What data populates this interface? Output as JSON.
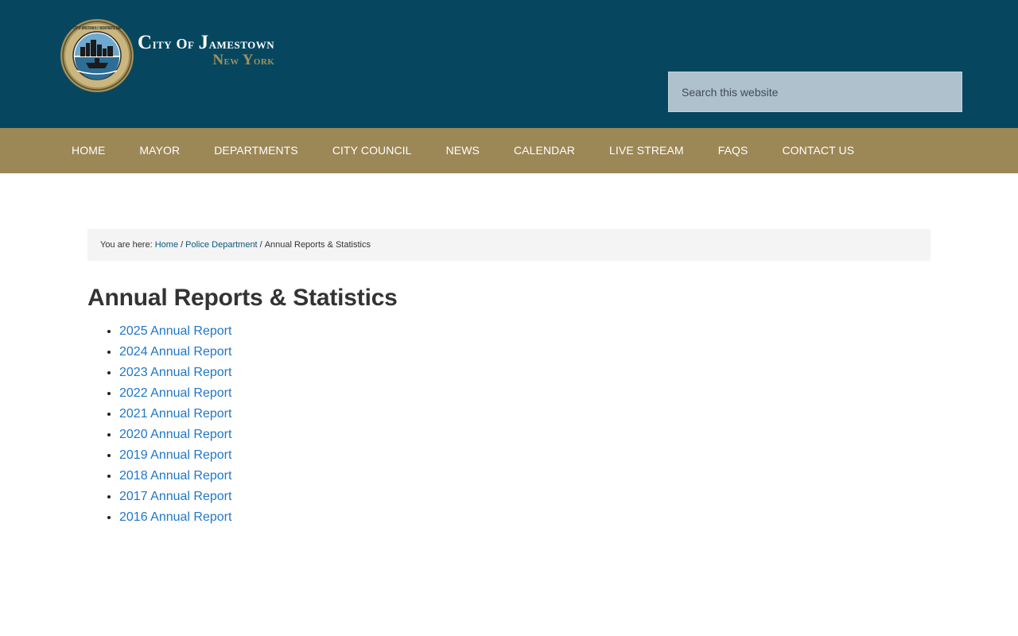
{
  "header": {
    "logo": {
      "city_text": "City of Jamestown",
      "state_text": "New York",
      "seal_text": "CITY OF JAMESTOWN N.Y. INCORPORATED 1886"
    },
    "search": {
      "placeholder": "Search this website",
      "value": ""
    }
  },
  "nav": {
    "items": [
      {
        "label": "HOME"
      },
      {
        "label": "MAYOR"
      },
      {
        "label": "DEPARTMENTS"
      },
      {
        "label": "CITY COUNCIL"
      },
      {
        "label": "NEWS"
      },
      {
        "label": "CALENDAR"
      },
      {
        "label": "LIVE STREAM"
      },
      {
        "label": "FAQS"
      },
      {
        "label": "CONTACT US"
      }
    ]
  },
  "breadcrumb": {
    "prefix": "You are here:",
    "links": [
      {
        "label": "Home"
      },
      {
        "label": "Police Department"
      }
    ],
    "separator": "/",
    "current": "Annual Reports & Statistics"
  },
  "main": {
    "title": "Annual Reports & Statistics",
    "reports": [
      {
        "label": "2025 Annual Report"
      },
      {
        "label": "2024 Annual Report"
      },
      {
        "label": "2023 Annual Report"
      },
      {
        "label": "2022 Annual Report"
      },
      {
        "label": "2021 Annual Report"
      },
      {
        "label": "2020 Annual Report"
      },
      {
        "label": "2019 Annual Report"
      },
      {
        "label": "2018 Annual Report"
      },
      {
        "label": "2017 Annual Report"
      },
      {
        "label": "2016 Annual Report"
      }
    ]
  },
  "colors": {
    "header_bg": "#06475f",
    "nav_bg": "#9c8757",
    "link": "#1f77c9",
    "gold": "#a3915c"
  }
}
